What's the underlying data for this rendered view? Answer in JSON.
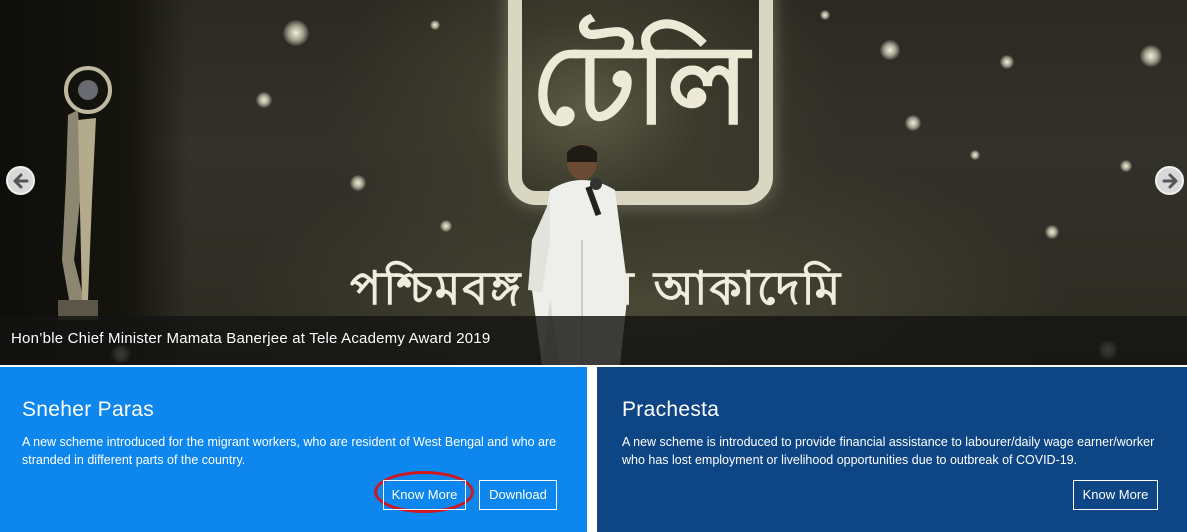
{
  "slider": {
    "caption": "Hon’ble Chief Minister Mamata Banerjee at Tele Academy Award 2019",
    "stage_text": "পশ্চিমবঙ্গ টেলি আকাদেমি",
    "logo_glyph": "টেলি",
    "prev_icon": "arrow-left-icon",
    "next_icon": "arrow-right-icon"
  },
  "panels": [
    {
      "title": "Sneher Paras",
      "description": "A new scheme introduced for the migrant workers, who are resident of West Bengal and who are stranded in different parts of the country.",
      "know_more_label": "Know More",
      "download_label": "Download",
      "color": "#0d87ee"
    },
    {
      "title": "Prachesta",
      "description": "A new scheme is introduced to provide financial assistance to labourer/daily wage earner/worker who has lost employment or livelihood opportunities due to outbreak of COVID-19.",
      "know_more_label": "Know More",
      "color": "#0e4585"
    }
  ],
  "colors": {
    "highlight_ring": "#d2161e",
    "caption_bg": "#141412"
  }
}
